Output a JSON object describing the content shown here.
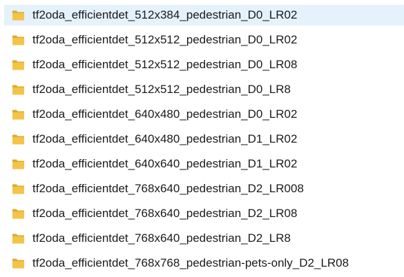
{
  "file_list": {
    "icon": "folder-icon",
    "folder_color": "#f4c449",
    "selected_row_color": "#e5f1fb",
    "items": [
      {
        "name": "tf2oda_efficientdet_512x384_pedestrian_D0_LR02",
        "selected": true
      },
      {
        "name": "tf2oda_efficientdet_512x512_pedestrian_D0_LR02",
        "selected": false
      },
      {
        "name": "tf2oda_efficientdet_512x512_pedestrian_D0_LR08",
        "selected": false
      },
      {
        "name": "tf2oda_efficientdet_512x512_pedestrian_D0_LR8",
        "selected": false
      },
      {
        "name": "tf2oda_efficientdet_640x480_pedestrian_D0_LR02",
        "selected": false
      },
      {
        "name": "tf2oda_efficientdet_640x480_pedestrian_D1_LR02",
        "selected": false
      },
      {
        "name": "tf2oda_efficientdet_640x640_pedestrian_D1_LR02",
        "selected": false
      },
      {
        "name": "tf2oda_efficientdet_768x640_pedestrian_D2_LR008",
        "selected": false
      },
      {
        "name": "tf2oda_efficientdet_768x640_pedestrian_D2_LR08",
        "selected": false
      },
      {
        "name": "tf2oda_efficientdet_768x640_pedestrian_D2_LR8",
        "selected": false
      },
      {
        "name": "tf2oda_efficientdet_768x768_pedestrian-pets-only_D2_LR08",
        "selected": false
      }
    ]
  }
}
